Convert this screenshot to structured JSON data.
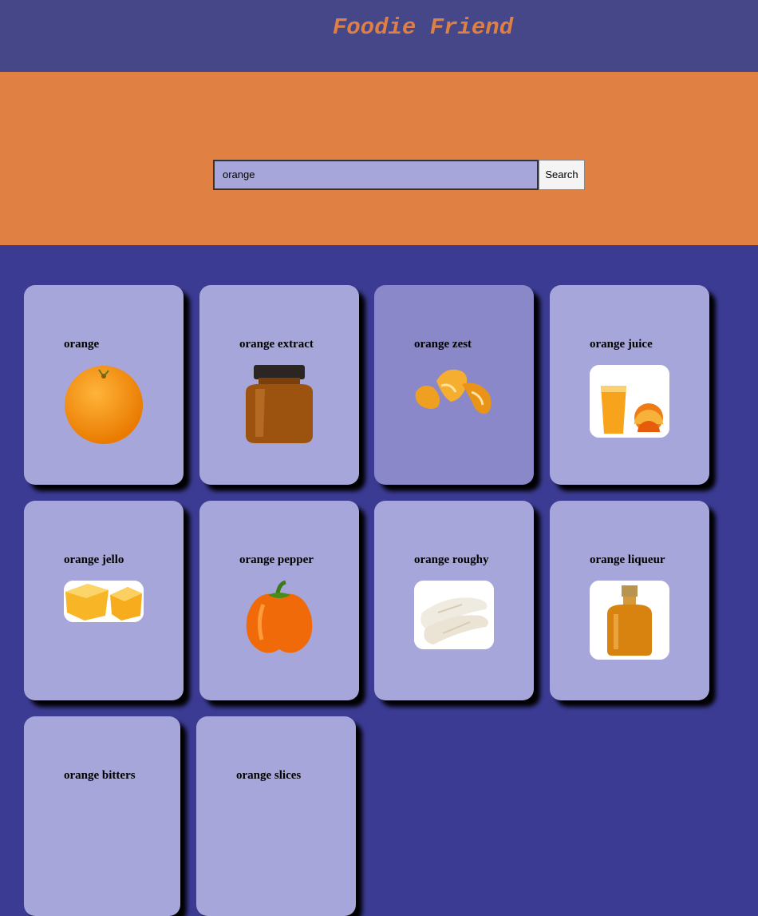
{
  "header": {
    "title": "Foodie Friend"
  },
  "search": {
    "value": "orange",
    "button_label": "Search"
  },
  "results": [
    {
      "name": "orange",
      "icon": "orange-fruit-icon"
    },
    {
      "name": "orange extract",
      "icon": "extract-jar-icon"
    },
    {
      "name": "orange zest",
      "icon": "orange-peel-icon"
    },
    {
      "name": "orange juice",
      "icon": "juice-glass-icon"
    },
    {
      "name": "orange jello",
      "icon": "jello-cubes-icon"
    },
    {
      "name": "orange pepper",
      "icon": "bell-pepper-icon"
    },
    {
      "name": "orange roughy",
      "icon": "fish-fillet-icon"
    },
    {
      "name": "orange liqueur",
      "icon": "liqueur-bottle-icon"
    },
    {
      "name": "orange bitters",
      "icon": "bitters-icon"
    },
    {
      "name": "orange slices",
      "icon": "orange-slices-icon"
    }
  ],
  "colors": {
    "header_bg": "#464788",
    "title": "#e07f43",
    "search_band": "#e08043",
    "page_bg": "#3b3b94",
    "card_bg": "#a6a6da"
  }
}
